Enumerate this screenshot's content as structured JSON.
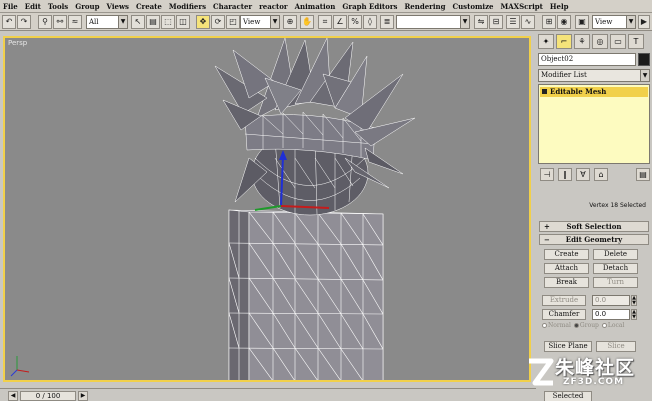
{
  "menu": [
    "File",
    "Edit",
    "Tools",
    "Group",
    "Views",
    "Create",
    "Modifiers",
    "Character",
    "reactor",
    "Animation",
    "Graph Editors",
    "Rendering",
    "Customize",
    "MAXScript",
    "Help"
  ],
  "toolbar": {
    "selection_filter": "All",
    "ref_coord": "View",
    "named_sel": "",
    "right_view": "View"
  },
  "viewport": {
    "label": "Persp"
  },
  "panel": {
    "object_name": "Object02",
    "modifier_list": "Modifier List",
    "stack_item": "Editable Mesh",
    "selection_status": "Vertex 18 Selected",
    "rollouts": {
      "soft_selection": "Soft Selection",
      "edit_geometry": "Edit Geometry"
    },
    "buttons": {
      "create": "Create",
      "delete": "Delete",
      "attach": "Attach",
      "detach": "Detach",
      "break": "Break",
      "turn": "Turn",
      "extrude": "Extrude",
      "chamfer": "Chamfer",
      "slice_plane": "Slice Plane",
      "slice": "Slice",
      "selected": "Selected"
    },
    "extrude_value": "0.0",
    "chamfer_value": "0.0",
    "radio": [
      "Normal",
      "Group",
      "Local"
    ]
  },
  "timebar": {
    "frame": "0 / 100"
  },
  "watermark": {
    "text": "朱峰社区",
    "sub": "ZF3D.COM"
  }
}
